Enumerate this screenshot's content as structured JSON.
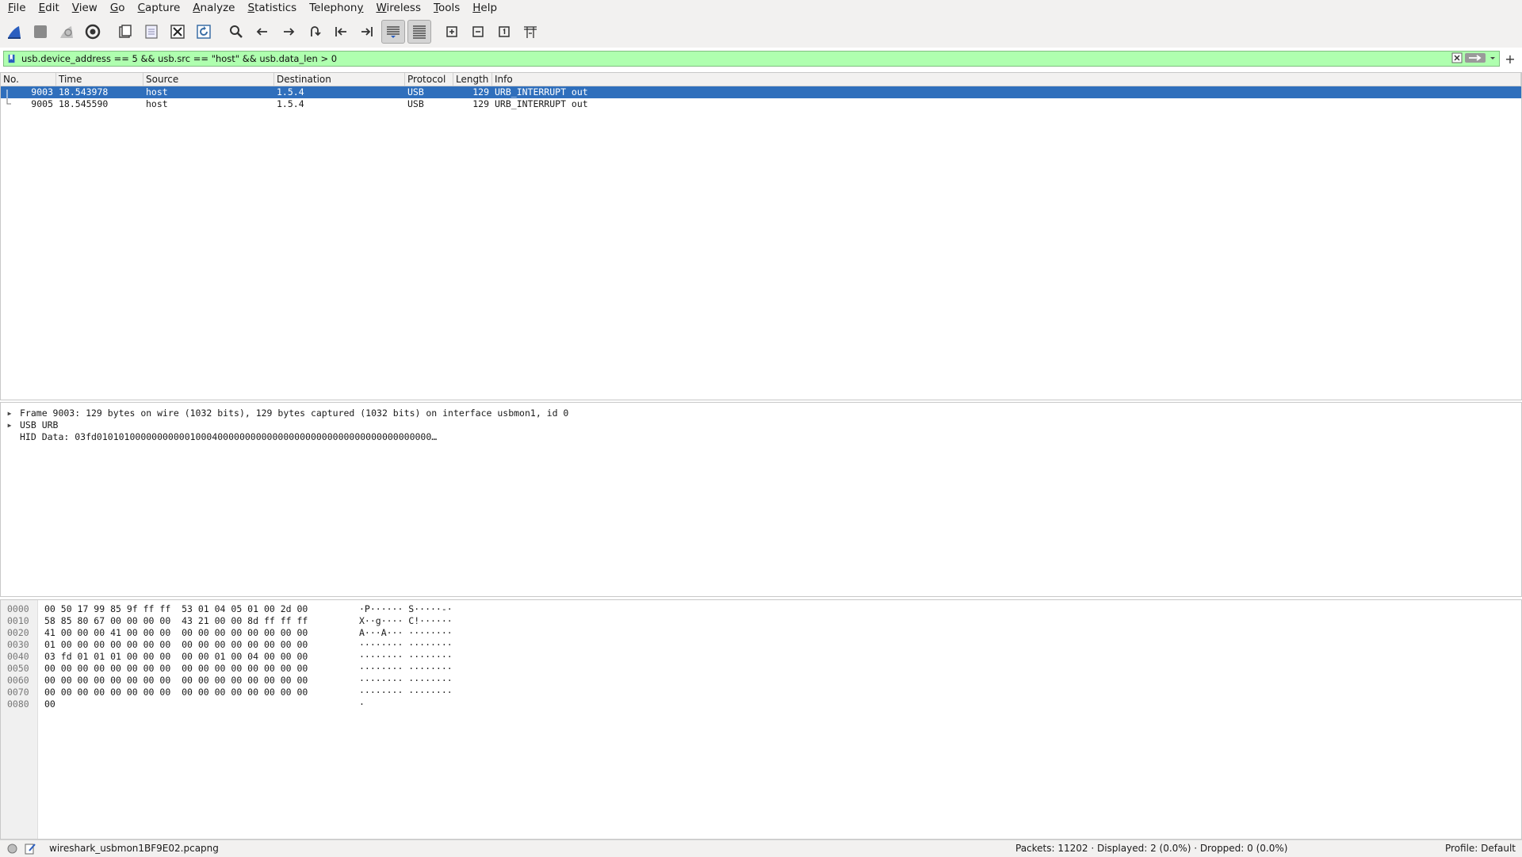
{
  "menu": [
    {
      "label": "File",
      "u": "F",
      "rest": "ile"
    },
    {
      "label": "Edit",
      "u": "E",
      "rest": "dit"
    },
    {
      "label": "View",
      "u": "V",
      "rest": "iew"
    },
    {
      "label": "Go",
      "u": "G",
      "rest": "o"
    },
    {
      "label": "Capture",
      "u": "C",
      "rest": "apture"
    },
    {
      "label": "Analyze",
      "u": "A",
      "rest": "nalyze"
    },
    {
      "label": "Statistics",
      "u": "S",
      "rest": "tatistics"
    },
    {
      "label": "Telephony",
      "pre": "Telephon",
      "u": "y",
      "rest": ""
    },
    {
      "label": "Wireless",
      "u": "W",
      "rest": "ireless"
    },
    {
      "label": "Tools",
      "u": "T",
      "rest": "ools"
    },
    {
      "label": "Help",
      "u": "H",
      "rest": "elp"
    }
  ],
  "filter": {
    "value": "usb.device_address == 5 && usb.src == \"host\" && usb.data_len > 0",
    "add_label": "+"
  },
  "packet_list": {
    "columns": [
      "No.",
      "Time",
      "Source",
      "Destination",
      "Protocol",
      "Length",
      "Info"
    ],
    "rows": [
      {
        "no": "9003",
        "time": "18.543978",
        "src": "host",
        "dst": "1.5.4",
        "proto": "USB",
        "len": "129",
        "info": "URB_INTERRUPT out",
        "selected": true
      },
      {
        "no": "9005",
        "time": "18.545590",
        "src": "host",
        "dst": "1.5.4",
        "proto": "USB",
        "len": "129",
        "info": "URB_INTERRUPT out",
        "selected": false
      }
    ]
  },
  "details": [
    {
      "text": "Frame 9003: 129 bytes on wire (1032 bits), 129 bytes captured (1032 bits) on interface usbmon1, id 0",
      "expandable": true
    },
    {
      "text": "USB URB",
      "expandable": true
    },
    {
      "text": "HID Data: 03fd0101010000000000010004000000000000000000000000000000000000000…",
      "expandable": false
    }
  ],
  "bytes": [
    {
      "off": "0000",
      "hex": "00 50 17 99 85 9f ff ff  53 01 04 05 01 00 2d 00",
      "ascii": "·P······ S·····-·"
    },
    {
      "off": "0010",
      "hex": "58 85 80 67 00 00 00 00  43 21 00 00 8d ff ff ff",
      "ascii": "X··g···· C!······"
    },
    {
      "off": "0020",
      "hex": "41 00 00 00 41 00 00 00  00 00 00 00 00 00 00 00",
      "ascii": "A···A··· ········"
    },
    {
      "off": "0030",
      "hex": "01 00 00 00 00 00 00 00  00 00 00 00 00 00 00 00",
      "ascii": "········ ········"
    },
    {
      "off": "0040",
      "hex": "03 fd 01 01 01 00 00 00  00 00 01 00 04 00 00 00",
      "ascii": "········ ········"
    },
    {
      "off": "0050",
      "hex": "00 00 00 00 00 00 00 00  00 00 00 00 00 00 00 00",
      "ascii": "········ ········"
    },
    {
      "off": "0060",
      "hex": "00 00 00 00 00 00 00 00  00 00 00 00 00 00 00 00",
      "ascii": "········ ········"
    },
    {
      "off": "0070",
      "hex": "00 00 00 00 00 00 00 00  00 00 00 00 00 00 00 00",
      "ascii": "········ ········"
    },
    {
      "off": "0080",
      "hex": "00",
      "ascii": "·"
    }
  ],
  "status": {
    "file": "wireshark_usbmon1BF9E02.pcapng",
    "packets": "Packets: 11202 · Displayed: 2 (0.0%) · Dropped: 0 (0.0%)",
    "profile": "Profile: Default"
  },
  "colors": {
    "filter_valid": "#afffaf",
    "selection": "#2f6fbc",
    "shark_blue": "#2a5ebf"
  }
}
